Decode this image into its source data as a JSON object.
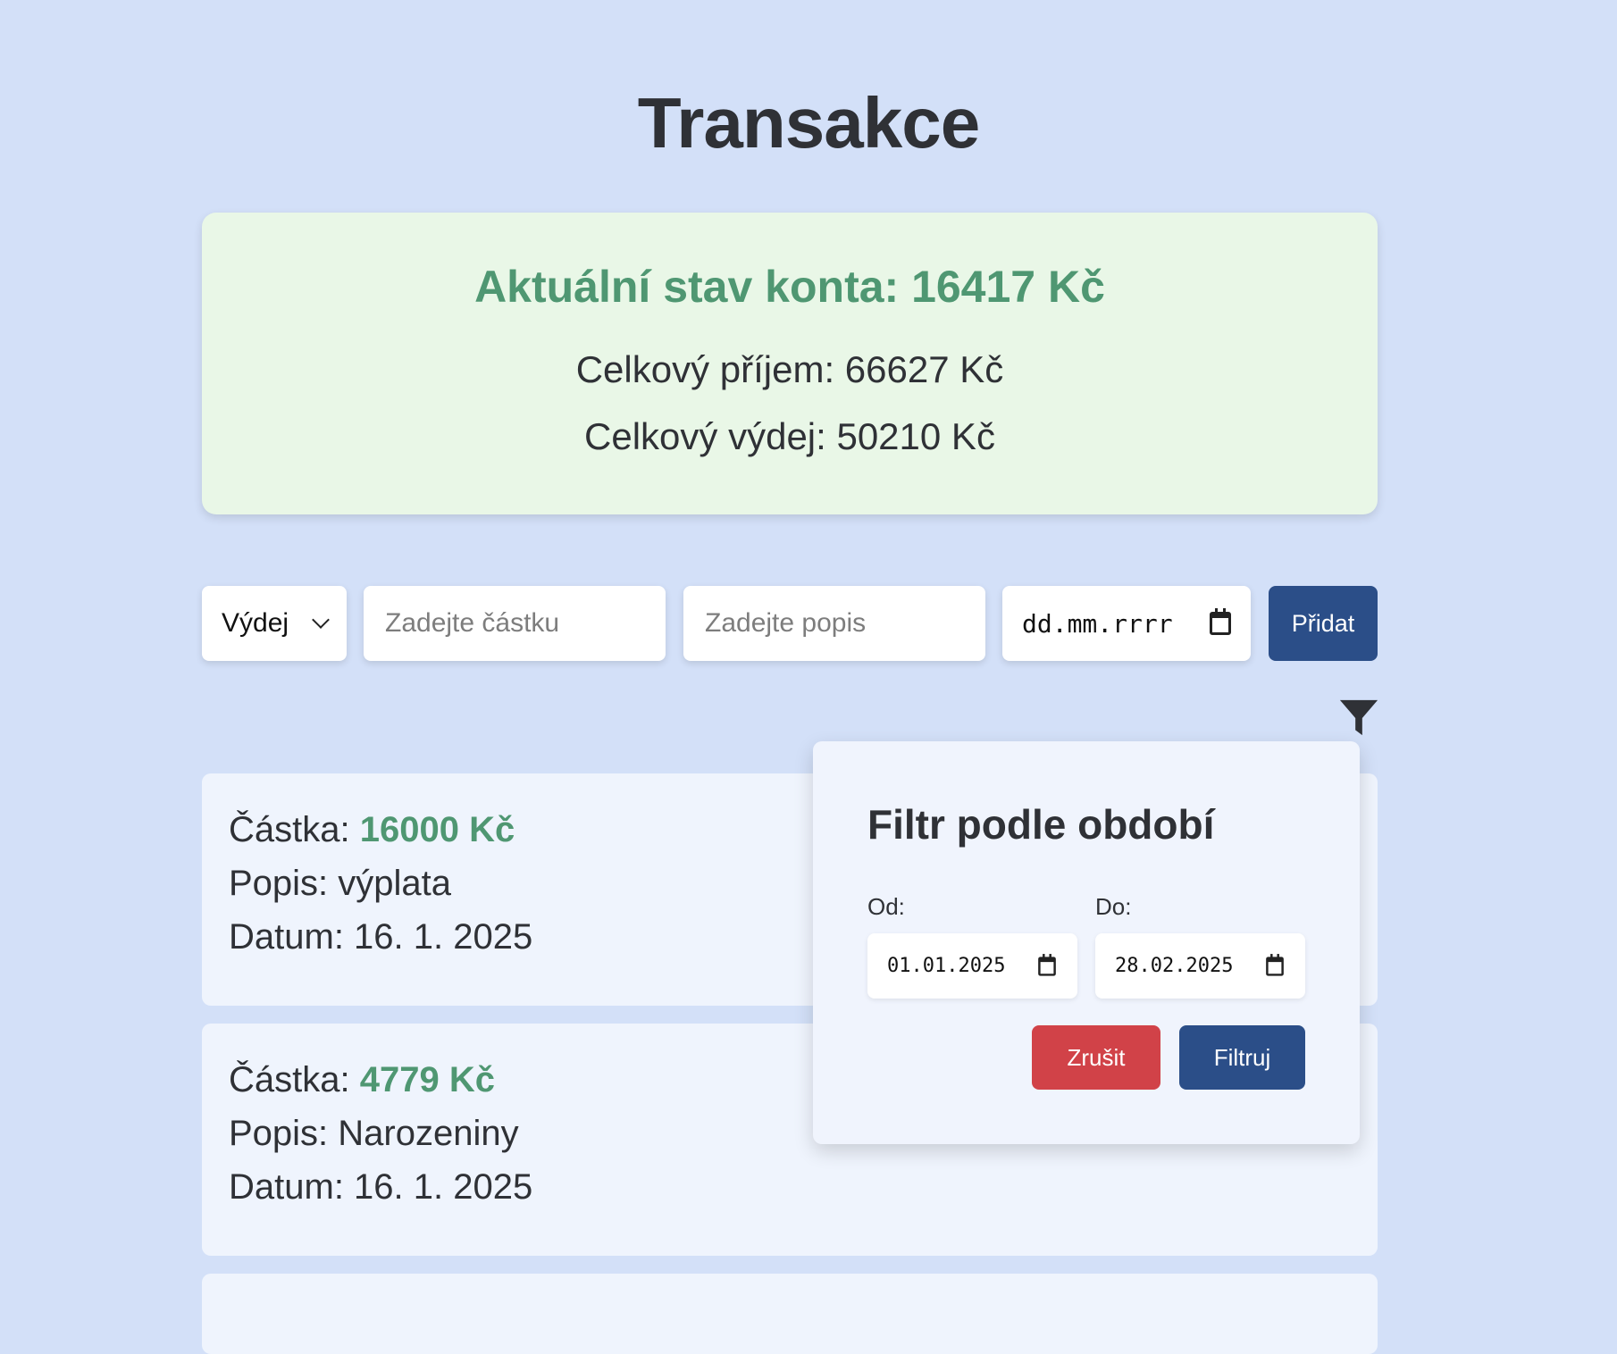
{
  "page": {
    "title": "Transakce"
  },
  "summary": {
    "balance": "Aktuální stav konta: 16417 Kč",
    "income": "Celkový příjem: 66627 Kč",
    "expense": "Celkový výdej: 50210 Kč"
  },
  "form": {
    "type_value": "Výdej",
    "amount_placeholder": "Zadejte částku",
    "description_placeholder": "Zadejte popis",
    "date_value": "dd.mm.rrrr",
    "add_label": "Přidat"
  },
  "transactions": [
    {
      "amount_label": "Částka:",
      "amount": "16000 Kč",
      "description": "Popis: výplata",
      "date": "Datum: 16. 1. 2025"
    },
    {
      "amount_label": "Částka:",
      "amount": "4779 Kč",
      "description": "Popis: Narozeniny",
      "date": "Datum: 16. 1. 2025"
    }
  ],
  "filter": {
    "title": "Filtr podle období",
    "from_label": "Od:",
    "to_label": "Do:",
    "from_value": "01.01.2025",
    "to_value": "28.02.2025",
    "cancel_label": "Zrušit",
    "apply_label": "Filtruj"
  },
  "icons": {
    "type_dropdown": "chevron-down-icon",
    "date_picker": "calendar-icon",
    "filter_toggle": "filter-icon"
  },
  "colors": {
    "background": "#d3e0f8",
    "summary_background": "#e9f7e7",
    "positive_amount": "#4f9772",
    "primary_button": "#2b4e88",
    "cancel_button": "#d14248"
  }
}
